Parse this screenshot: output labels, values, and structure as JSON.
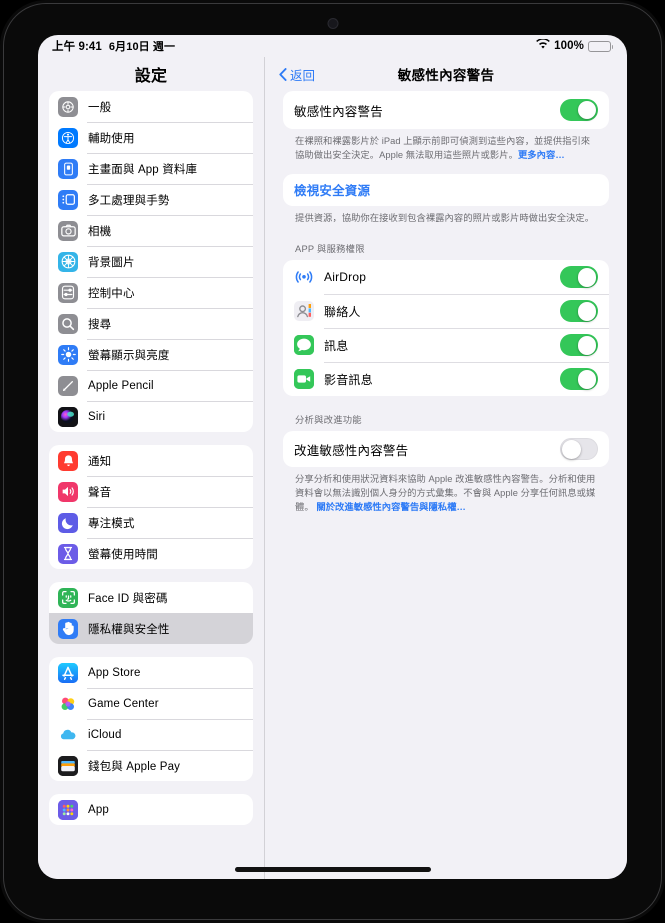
{
  "status_bar": {
    "time": "上午 9:41",
    "date": "6月10日 週一",
    "battery_percent": "100%",
    "wifi_icon": "wifi-icon",
    "battery_icon": "battery-full-icon"
  },
  "sidebar": {
    "title": "設定",
    "groups": [
      {
        "items": [
          {
            "label": "一般",
            "icon": "gear-icon",
            "color": "#8e8e93",
            "selected": false
          },
          {
            "label": "輔助使用",
            "icon": "accessibility-icon",
            "color": "#007aff",
            "selected": false
          },
          {
            "label": "主畫面與 App 資料庫",
            "icon": "home-screen-icon",
            "color": "#2f7cf6",
            "selected": false
          },
          {
            "label": "多工處理與手勢",
            "icon": "multitasking-icon",
            "color": "#2f7cf6",
            "selected": false
          },
          {
            "label": "相機",
            "icon": "camera-icon",
            "color": "#8e8e93",
            "selected": false
          },
          {
            "label": "背景圖片",
            "icon": "wallpaper-icon",
            "color": "#34b4e8",
            "selected": false
          },
          {
            "label": "控制中心",
            "icon": "control-center-icon",
            "color": "#8e8e93",
            "selected": false
          },
          {
            "label": "搜尋",
            "icon": "search-icon",
            "color": "#8e8e93",
            "selected": false
          },
          {
            "label": "螢幕顯示與亮度",
            "icon": "brightness-icon",
            "color": "#2f7cf6",
            "selected": false
          },
          {
            "label": "Apple Pencil",
            "icon": "apple-pencil-icon",
            "color": "#8e8e93",
            "selected": false
          },
          {
            "label": "Siri",
            "icon": "siri-icon",
            "color": "#1c1c1e",
            "selected": false
          }
        ]
      },
      {
        "items": [
          {
            "label": "通知",
            "icon": "notifications-bell-icon",
            "color": "#ff3b30",
            "selected": false
          },
          {
            "label": "聲音",
            "icon": "sound-speaker-icon",
            "color": "#f0376a",
            "selected": false
          },
          {
            "label": "專注模式",
            "icon": "focus-moon-icon",
            "color": "#5e5ce6",
            "selected": false
          },
          {
            "label": "螢幕使用時間",
            "icon": "screen-time-hourglass-icon",
            "color": "#6c5ce7",
            "selected": false
          }
        ]
      },
      {
        "items": [
          {
            "label": "Face ID 與密碼",
            "icon": "face-id-icon",
            "color": "#2fb457",
            "selected": false
          },
          {
            "label": "隱私權與安全性",
            "icon": "privacy-hand-icon",
            "color": "#2f7cf6",
            "selected": true
          }
        ]
      },
      {
        "items": [
          {
            "label": "App Store",
            "icon": "app-store-icon",
            "color": "#1f8fff",
            "selected": false
          },
          {
            "label": "Game Center",
            "icon": "game-center-icon",
            "color": "#ffffff",
            "selected": false
          },
          {
            "label": "iCloud",
            "icon": "icloud-icon",
            "color": "#ffffff",
            "selected": false
          },
          {
            "label": "錢包與 Apple Pay",
            "icon": "wallet-icon",
            "color": "#1c1c1e",
            "selected": false
          }
        ]
      },
      {
        "items": [
          {
            "label": "App",
            "icon": "app-grid-icon",
            "color": "#6c5ce7",
            "selected": false
          }
        ]
      }
    ]
  },
  "detail": {
    "back_label": "返回",
    "title": "敏感性內容警告",
    "main_toggle": {
      "label": "敏感性內容警告",
      "state": "on"
    },
    "main_note": {
      "text": "在裸照和裸露影片於 iPad 上顯示前即可偵測到這些內容，並提供指引來協助做出安全決定。Apple 無法取用這些照片或影片。",
      "link": "更多內容…"
    },
    "safety_link": {
      "label": "檢視安全資源",
      "note": "提供資源，協助你在接收到包含裸露內容的照片或影片時做出安全決定。"
    },
    "permissions": {
      "header": "APP 與服務權限",
      "rows": [
        {
          "label": "AirDrop",
          "icon": "airdrop-icon",
          "color": "#ffffff",
          "state": "on"
        },
        {
          "label": "聯絡人",
          "icon": "contacts-icon",
          "color": "#ffffff",
          "state": "on"
        },
        {
          "label": "訊息",
          "icon": "messages-icon",
          "color": "#34c759",
          "state": "on"
        },
        {
          "label": "影音訊息",
          "icon": "video-message-icon",
          "color": "#34c759",
          "state": "on"
        }
      ]
    },
    "analytics": {
      "header": "分析與改進功能",
      "toggle_label": "改進敏感性內容警告",
      "state": "off",
      "note": "分享分析和使用狀況資料來協助 Apple 改進敏感性內容警告。分析和使用資料會以無法識別個人身分的方式彙集。不會與 Apple 分享任何訊息或媒體。",
      "link": "關於改進敏感性內容警告與隱私權…"
    }
  },
  "colors": {
    "accent": "#2e7bf6",
    "toggle_on": "#34c759",
    "background": "#f2f1f6",
    "card": "#ffffff",
    "selected_row": "#d4d3d8"
  }
}
